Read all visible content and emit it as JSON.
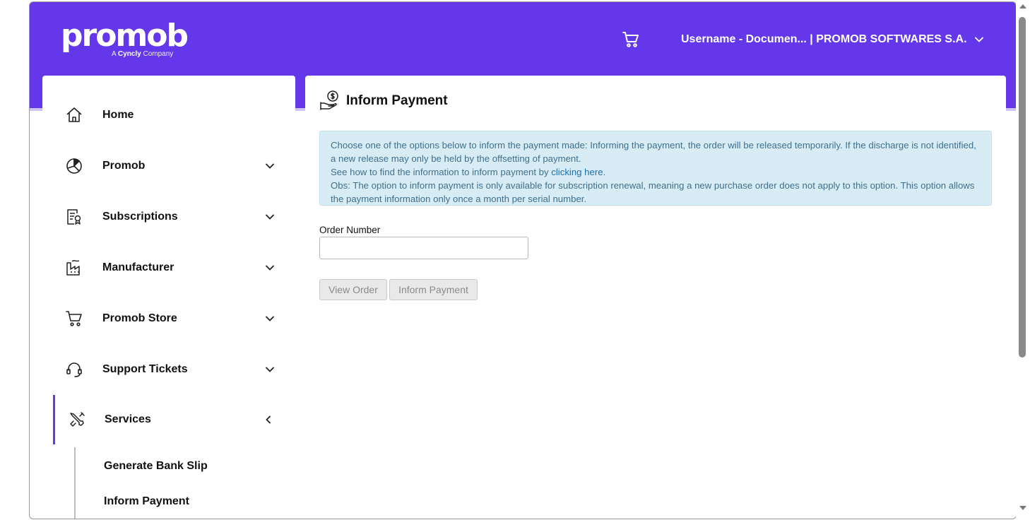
{
  "header": {
    "logo_text": "promob",
    "logo_tagline_prefix": "A",
    "logo_tagline_brand": "Cyncly",
    "logo_tagline_suffix": "Company",
    "user_menu_label": "Username - Documen... | PROMOB SOFTWARES S.A.",
    "cart_icon": "cart-icon",
    "accent_color": "#6438ea"
  },
  "sidebar": {
    "items": [
      {
        "label": "Home",
        "icon": "home-icon"
      },
      {
        "label": "Promob",
        "icon": "promob-icon"
      },
      {
        "label": "Subscriptions",
        "icon": "subscriptions-icon"
      },
      {
        "label": "Manufacturer",
        "icon": "factory-icon"
      },
      {
        "label": "Promob Store",
        "icon": "cart-icon"
      },
      {
        "label": "Support Tickets",
        "icon": "headset-icon"
      },
      {
        "label": "Services",
        "icon": "tools-icon"
      }
    ],
    "sub_items": [
      {
        "label": "Generate Bank Slip"
      },
      {
        "label": "Inform Payment"
      }
    ]
  },
  "main": {
    "title": "Inform Payment",
    "info": {
      "line1": "Choose one of the options below to inform the payment made: Informing the payment, the order will be released temporarily. If the discharge is not identified, a new release may only be held by the offsetting of payment.",
      "line2_prefix": "See how to find the information to inform payment by",
      "line2_link": "clicking here",
      "line2_suffix": ".",
      "line3": "Obs: The option to inform payment is only available for subscription renewal, meaning a new purchase order does not apply to this option. This option allows the payment information only once a month per serial number."
    },
    "order_number_label": "Order Number",
    "order_number_value": "",
    "view_order_button": "View Order",
    "inform_payment_button": "Inform Payment"
  }
}
